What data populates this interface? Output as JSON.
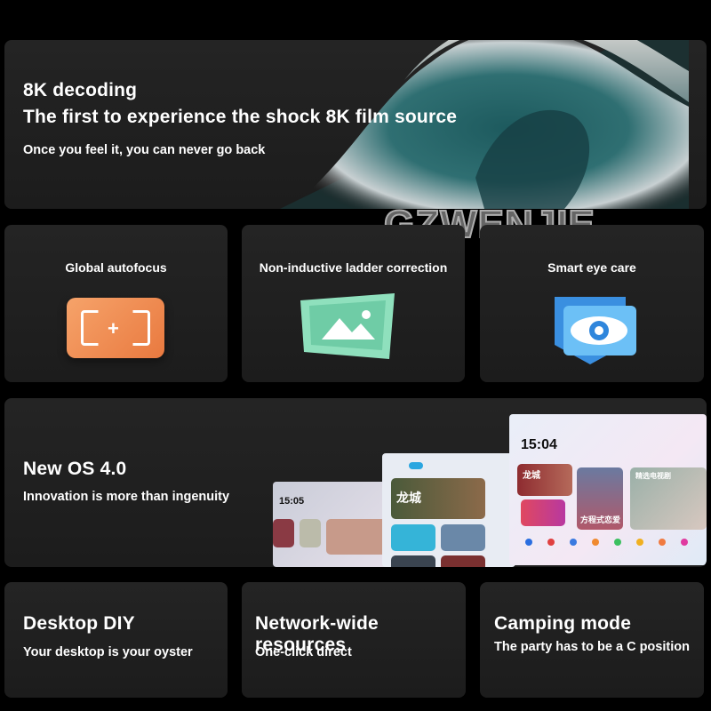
{
  "hero": {
    "title": "8K decoding",
    "headline": "The first to experience the shock 8K film source",
    "subtitle": "Once you feel it, you can never go back"
  },
  "watermark": "GZWENJIE",
  "features": [
    {
      "label": "Global autofocus",
      "icon": "autofocus-icon",
      "color": "#f0935a"
    },
    {
      "label": "Non-inductive ladder correction",
      "icon": "image-keystone-icon",
      "color": "#7fd6b0"
    },
    {
      "label": "Smart eye care",
      "icon": "eye-icon",
      "color": "#4aa8f0"
    }
  ],
  "os": {
    "title": "New OS 4.0",
    "subtitle": "Innovation is more than ingenuity",
    "screens": {
      "left_time": "15:05",
      "right_time": "15:04",
      "right_tile1": "龙城",
      "right_tile2": "方程式恋爱",
      "right_tile3": "精选电视剧",
      "middle_tile": "龙城"
    }
  },
  "bottom": [
    {
      "title": "Desktop DIY",
      "subtitle": "Your desktop is your oyster"
    },
    {
      "title": "Network-wide resources",
      "subtitle": "One-click direct"
    },
    {
      "title": "Camping mode",
      "subtitle": "The party has to be a C position"
    }
  ]
}
